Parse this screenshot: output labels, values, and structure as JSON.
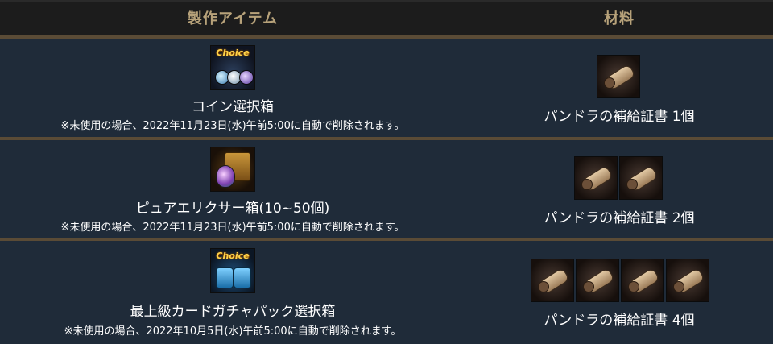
{
  "header": {
    "col_item": "製作アイテム",
    "col_material": "材料"
  },
  "rows": [
    {
      "icon": "choice-coin-box-icon",
      "name": "コイン選択箱",
      "note": "※未使用の場合、2022年11月23日(水)午前5:00に自動で削除されます。",
      "material": "パンドラの補給証書 1個",
      "material_count": 1
    },
    {
      "icon": "pure-elixir-box-icon",
      "name": "ピュアエリクサー箱(10~50個)",
      "note": "※未使用の場合、2022年11月23日(水)午前5:00に自動で削除されます。",
      "material": "パンドラの補給証書 2個",
      "material_count": 2
    },
    {
      "icon": "card-gacha-pack-box-icon",
      "name": "最上級カードガチャパック選択箱",
      "note": "※未使用の場合、2022年10月5日(水)午前5:00に自動で削除されます。",
      "material": "パンドラの補給証書 4個",
      "material_count": 4
    }
  ],
  "icon_labels": {
    "choice": "Choice"
  },
  "colors": {
    "header_text": "#b7a27a",
    "row_bg": "#1f2b39",
    "separator": "#5a4b36"
  }
}
